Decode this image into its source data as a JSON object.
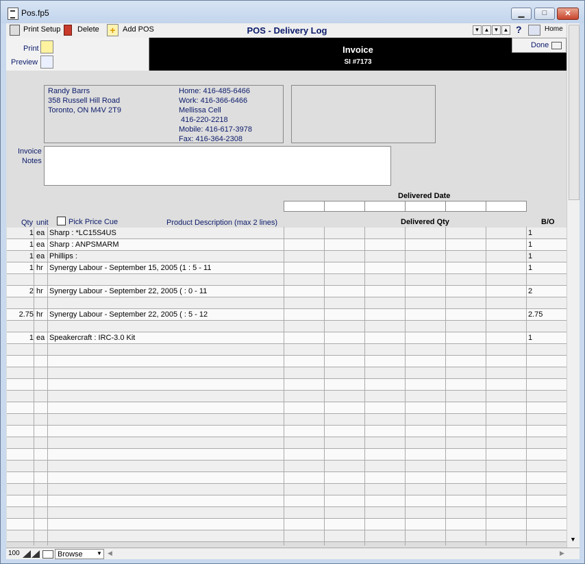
{
  "window": {
    "title": "Pos.fp5"
  },
  "toolbar": {
    "print_setup": "Print Setup",
    "delete": "Delete",
    "add_pos": "Add POS",
    "app_title": "POS - Delivery Log",
    "help": "?",
    "home": "Home"
  },
  "left_panel": {
    "print": "Print",
    "preview": "Preview"
  },
  "header": {
    "title": "Invoice",
    "number": "SI #7173"
  },
  "done": "Done",
  "customer": {
    "name": "Randy Barrs",
    "address1": "358 Russell Hill Road",
    "address2": "Toronto, ON M4V 2T9",
    "home": "Home: 416-485-6466",
    "work": "Work: 416-366-6466",
    "cell_label": "Mellissa Cell",
    "cell": " 416-220-2218",
    "mobile": "Mobile: 416-617-3978",
    "fax": "Fax: 416-364-2308"
  },
  "notes": {
    "label1": "Invoice",
    "label2": "Notes",
    "value": ""
  },
  "delivered_date_label": "Delivered Date",
  "columns": {
    "qty": "Qty",
    "unit": "unit",
    "pick_price_cue": "Pick Price Cue",
    "product_description": "Product Description (max 2 lines)",
    "delivered_qty": "Delivered Qty",
    "bo": "B/O"
  },
  "rows": [
    {
      "qty": "1",
      "unit": "ea",
      "desc": "Sharp : *LC15S4US",
      "bo": "1"
    },
    {
      "qty": "1",
      "unit": "ea",
      "desc": "Sharp : ANPSMARM",
      "bo": "1"
    },
    {
      "qty": "1",
      "unit": "ea",
      "desc": "Phillips :",
      "bo": "1"
    },
    {
      "qty": "1",
      "unit": "hr",
      "desc": "Synergy Labour - September 15, 2005 (1 : 5 - 11",
      "bo": "1"
    },
    {
      "qty": "",
      "unit": "",
      "desc": "",
      "bo": ""
    },
    {
      "qty": "2",
      "unit": "hr",
      "desc": "Synergy Labour - September 22, 2005 ( : 0 - 11",
      "bo": "2"
    },
    {
      "qty": "",
      "unit": "",
      "desc": "",
      "bo": ""
    },
    {
      "qty": "2.75",
      "unit": "hr",
      "desc": "Synergy Labour - September 22, 2005 ( : 5 - 12",
      "bo": "2.75"
    },
    {
      "qty": "",
      "unit": "",
      "desc": "",
      "bo": ""
    },
    {
      "qty": "1",
      "unit": "ea",
      "desc": "Speakercraft : IRC-3.0 Kit",
      "bo": "1"
    },
    {
      "qty": "",
      "unit": "",
      "desc": "",
      "bo": ""
    },
    {
      "qty": "",
      "unit": "",
      "desc": "",
      "bo": ""
    },
    {
      "qty": "",
      "unit": "",
      "desc": "",
      "bo": ""
    },
    {
      "qty": "",
      "unit": "",
      "desc": "",
      "bo": ""
    },
    {
      "qty": "",
      "unit": "",
      "desc": "",
      "bo": ""
    },
    {
      "qty": "",
      "unit": "",
      "desc": "",
      "bo": ""
    },
    {
      "qty": "",
      "unit": "",
      "desc": "",
      "bo": ""
    },
    {
      "qty": "",
      "unit": "",
      "desc": "",
      "bo": ""
    },
    {
      "qty": "",
      "unit": "",
      "desc": "",
      "bo": ""
    },
    {
      "qty": "",
      "unit": "",
      "desc": "",
      "bo": ""
    },
    {
      "qty": "",
      "unit": "",
      "desc": "",
      "bo": ""
    },
    {
      "qty": "",
      "unit": "",
      "desc": "",
      "bo": ""
    },
    {
      "qty": "",
      "unit": "",
      "desc": "",
      "bo": ""
    },
    {
      "qty": "",
      "unit": "",
      "desc": "",
      "bo": ""
    },
    {
      "qty": "",
      "unit": "",
      "desc": "",
      "bo": ""
    },
    {
      "qty": "",
      "unit": "",
      "desc": "",
      "bo": ""
    },
    {
      "qty": "",
      "unit": "",
      "desc": "",
      "bo": ""
    }
  ],
  "status": {
    "zoom": "100",
    "mode": "Browse"
  },
  "icons": [
    "printer-icon",
    "trash-icon",
    "plus-icon",
    "print-icon",
    "magnifier-icon",
    "home-icon",
    "done-arrow-icon"
  ]
}
